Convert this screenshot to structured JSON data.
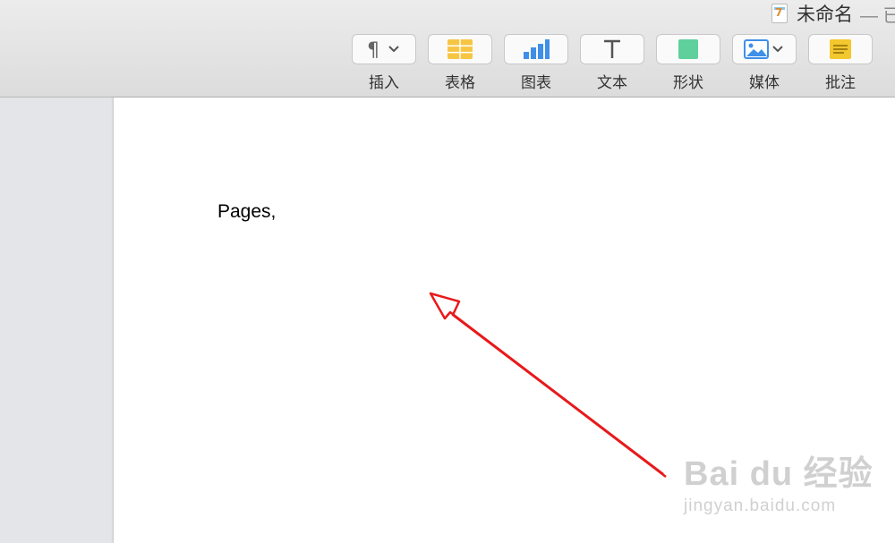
{
  "window": {
    "title": "未命名",
    "title_suffix": "— 已"
  },
  "toolbar": {
    "items": [
      {
        "label": "插入",
        "icon": "paragraph-icon"
      },
      {
        "label": "表格",
        "icon": "table-icon"
      },
      {
        "label": "图表",
        "icon": "chart-icon"
      },
      {
        "label": "文本",
        "icon": "text-icon"
      },
      {
        "label": "形状",
        "icon": "shape-icon"
      },
      {
        "label": "媒体",
        "icon": "media-icon"
      },
      {
        "label": "批注",
        "icon": "comment-icon"
      }
    ],
    "colors": {
      "table": "#f6c643",
      "chart": "#3f8fe8",
      "shape": "#5fd09b",
      "comment": "#f3c72e"
    }
  },
  "document": {
    "body_text": "Pages,"
  },
  "annotation": {
    "color": "#e8191a"
  },
  "watermark": {
    "main": "Bai du 经验",
    "sub": "jingyan.baidu.com"
  }
}
